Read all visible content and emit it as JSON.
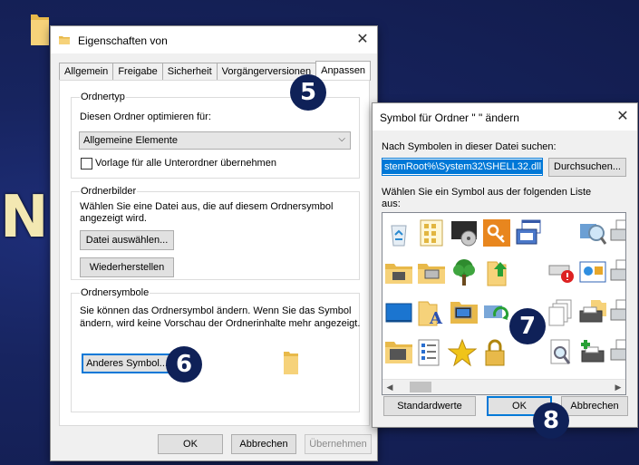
{
  "props_window": {
    "title": "Eigenschaften von",
    "tabs": [
      "Allgemein",
      "Freigabe",
      "Sicherheit",
      "Vorgängerversionen",
      "Anpassen"
    ],
    "active_tab": "Anpassen",
    "ordnertyp": {
      "legend": "Ordnertyp",
      "optimize_label": "Diesen Ordner optimieren für:",
      "optimize_value": "Allgemeine Elemente",
      "checkbox_label": "Vorlage für alle Unterordner übernehmen",
      "checkbox_checked": false
    },
    "ordnerbilder": {
      "legend": "Ordnerbilder",
      "desc_line1": "Wählen Sie eine Datei aus, die auf diesem Ordnersymbol",
      "desc_line2": "angezeigt wird.",
      "choose_file_button": "Datei auswählen...",
      "restore_button": "Wiederherstellen"
    },
    "ordnersymbole": {
      "legend": "Ordnersymbole",
      "desc_line1": "Sie können das Ordnersymbol ändern. Wenn Sie das Symbol",
      "desc_line2": "ändern, wird keine Vorschau der Ordnerinhalte mehr angezeigt.",
      "change_icon_button": "Anderes Symbol..."
    },
    "footer": {
      "ok": "OK",
      "cancel": "Abbrechen",
      "apply": "Übernehmen"
    }
  },
  "symbol_dialog": {
    "title": "Symbol für Ordner \" \" ändern",
    "search_label": "Nach Symbolen in dieser Datei suchen:",
    "file_path": "stemRoot%\\System32\\SHELL32.dll",
    "browse_button": "Durchsuchen...",
    "list_label_line1": "Wählen Sie ein Symbol aus der folgenden Liste",
    "list_label_line2": "aus:",
    "icons": [
      "recycle-bin-icon",
      "document-grid-icon",
      "media-player-icon",
      "key-icon",
      "program-window-icon",
      "empty-slot",
      "search-magnifier-icon",
      "printer-icon",
      "folder-network-icon",
      "folder-printer-icon",
      "tree-icon",
      "folder-up-arrow-icon",
      "network-error-icon",
      "control-panel-icon",
      "printer-icon",
      "desktop-blue-icon",
      "folder-font-icon",
      "folder-computer-icon",
      "sync-icon",
      "empty-slot",
      "documents-stack-icon",
      "printer-folder-icon",
      "folder-checklist-icon",
      "checklist-icon",
      "star-icon",
      "lock-icon",
      "empty-slot",
      "document-magnifier-icon",
      "add-printer-icon"
    ],
    "defaults_button": "Standardwerte",
    "ok": "OK",
    "cancel": "Abbrechen"
  },
  "step_badges": {
    "b5": "5",
    "b6": "6",
    "b7": "7",
    "b8": "8"
  },
  "desktop_letter": "N",
  "colors": {
    "accent": "#0078d7",
    "badge": "#0f2158",
    "desktop": "#17245f"
  }
}
